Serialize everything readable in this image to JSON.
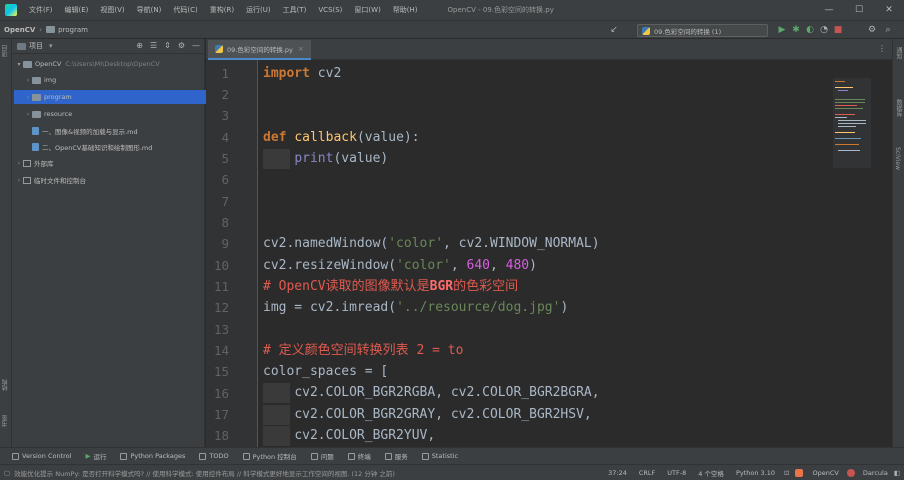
{
  "menu": {
    "items": [
      "文件(F)",
      "编辑(E)",
      "视图(V)",
      "导航(N)",
      "代码(C)",
      "重构(R)",
      "运行(U)",
      "工具(T)",
      "VCS(S)",
      "窗口(W)",
      "帮助(H)"
    ],
    "window_title": "OpenCV - 09.色彩空间的转换.py"
  },
  "window_controls": {
    "minimize": "—",
    "maximize": "☐",
    "close": "✕"
  },
  "nav": {
    "project": "OpenCV",
    "folder": "program",
    "run_config": "09.色彩空间的转换 (1)"
  },
  "project_panel": {
    "title": "项目",
    "root": {
      "name": "OpenCV",
      "path": "C:\\Users\\MI\\Desktop\\OpenCV"
    },
    "items": [
      {
        "name": "img",
        "type": "folder"
      },
      {
        "name": "program",
        "type": "folder",
        "selected": true
      },
      {
        "name": "resource",
        "type": "folder"
      },
      {
        "name": "一、图像&视频的加载与显示.md",
        "type": "file"
      },
      {
        "name": "二、OpenCV基础知识和绘制图形.md",
        "type": "file"
      }
    ],
    "external_libs": "外部库",
    "scratches": "临时文件和控制台"
  },
  "left_stripe": {
    "top": "项目",
    "middle": "结构",
    "bottom": "书签"
  },
  "editor": {
    "tab_label": "09.色彩空间的转换.py",
    "tab_close": "×",
    "line_numbers": [
      "1",
      "2",
      "3",
      "4",
      "5",
      "6",
      "7",
      "8",
      "9",
      "10",
      "11",
      "12",
      "13",
      "14",
      "15",
      "16",
      "17",
      "18"
    ],
    "code": {
      "l1_kw": "import",
      "l1_rest": " cv2",
      "l4_kw": "def",
      "l4_fn": "callback",
      "l4_open": "(",
      "l4_param": "value",
      "l4_close": "):",
      "l5_builtin": "print",
      "l5_rest": "(value)",
      "l9_a": "cv2.namedWindow(",
      "l9_str": "'color'",
      "l9_b": ", cv2.WINDOW_NORMAL)",
      "l10_a": "cv2.resizeWindow(",
      "l10_str": "'color'",
      "l10_b": ", ",
      "l10_n1": "640",
      "l10_c": ", ",
      "l10_n2": "480",
      "l10_d": ")",
      "l11_a": "# OpenCV读取的图像默认是",
      "l11_b": "BGR",
      "l11_c": "的色彩空间",
      "l12_a": "img = cv2.imread(",
      "l12_str": "'../resource/dog.jpg'",
      "l12_b": ")",
      "l14_a": "# 定义颜色空间转换列表 ",
      "l14_b": "2 = to",
      "l15": "color_spaces = [",
      "l16": "cv2.COLOR_BGR2RGBA, cv2.COLOR_BGR2BGRA,",
      "l17": "cv2.COLOR_BGR2GRAY, cv2.COLOR_BGR2HSV,",
      "l18": "cv2.COLOR_BGR2YUV,"
    }
  },
  "right_stripe": {
    "top": "通知",
    "middle": "数据库",
    "bottom": "SciView"
  },
  "bottom_tabs": [
    "Version Control",
    "运行",
    "Python Packages",
    "TODO",
    "Python 控制台",
    "问题",
    "终端",
    "服务",
    "Statistic"
  ],
  "status": {
    "message": "效能优化提示 NumPy: 是否打开科学模式吗? // 使用科学模式: 使用控件布局 // 科学模式更好地显示工作空间的视图. (12 分钟 之前)",
    "position": "37:24",
    "line_sep": "CRLF",
    "encoding": "UTF-8",
    "indent": "4 个空格",
    "interpreter": "Python 3.10",
    "project": "OpenCV",
    "theme": "Darcula"
  },
  "colors": {
    "accent": "#2f65ca",
    "keyword": "#cc7832",
    "function": "#ffc66d",
    "string": "#6a8759",
    "number": "#6897bb",
    "comment": "#e05a4f"
  }
}
